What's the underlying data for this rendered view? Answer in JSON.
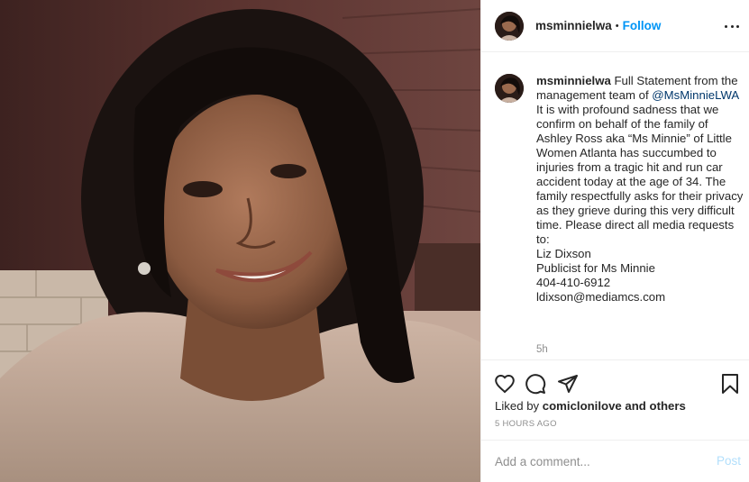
{
  "post": {
    "username": "msminnielwa",
    "follow_label": "Follow",
    "separator": "•",
    "more_icon": "ellipsis-icon"
  },
  "caption": {
    "username": "msminnielwa",
    "lines": [
      " Full Statement from the management team of ",
      "@MsMinnieLWA",
      "\nIt is with profound sadness that we confirm on behalf of the family of Ashley Ross aka “Ms Minnie” of Little Women Atlanta has succumbed to injuries from a tragic hit and run car accident today at the age of 34. The family respectfully asks for their privacy as they grieve during this very difficult time. Please direct all media requests to:\nLiz Dixson\nPublicist for Ms Minnie\n404-410-6912\nldixson@mediamcs.com"
    ],
    "time": "5h"
  },
  "actions": {
    "icons": [
      "heart-icon",
      "comment-icon",
      "share-icon",
      "bookmark-icon"
    ],
    "liked_by_prefix": "Liked by ",
    "liked_by_user": "comiclonilove",
    "liked_by_suffix": " and others",
    "date": "5 HOURS AGO"
  },
  "comment": {
    "placeholder": "Add a comment...",
    "post_label": "Post"
  }
}
